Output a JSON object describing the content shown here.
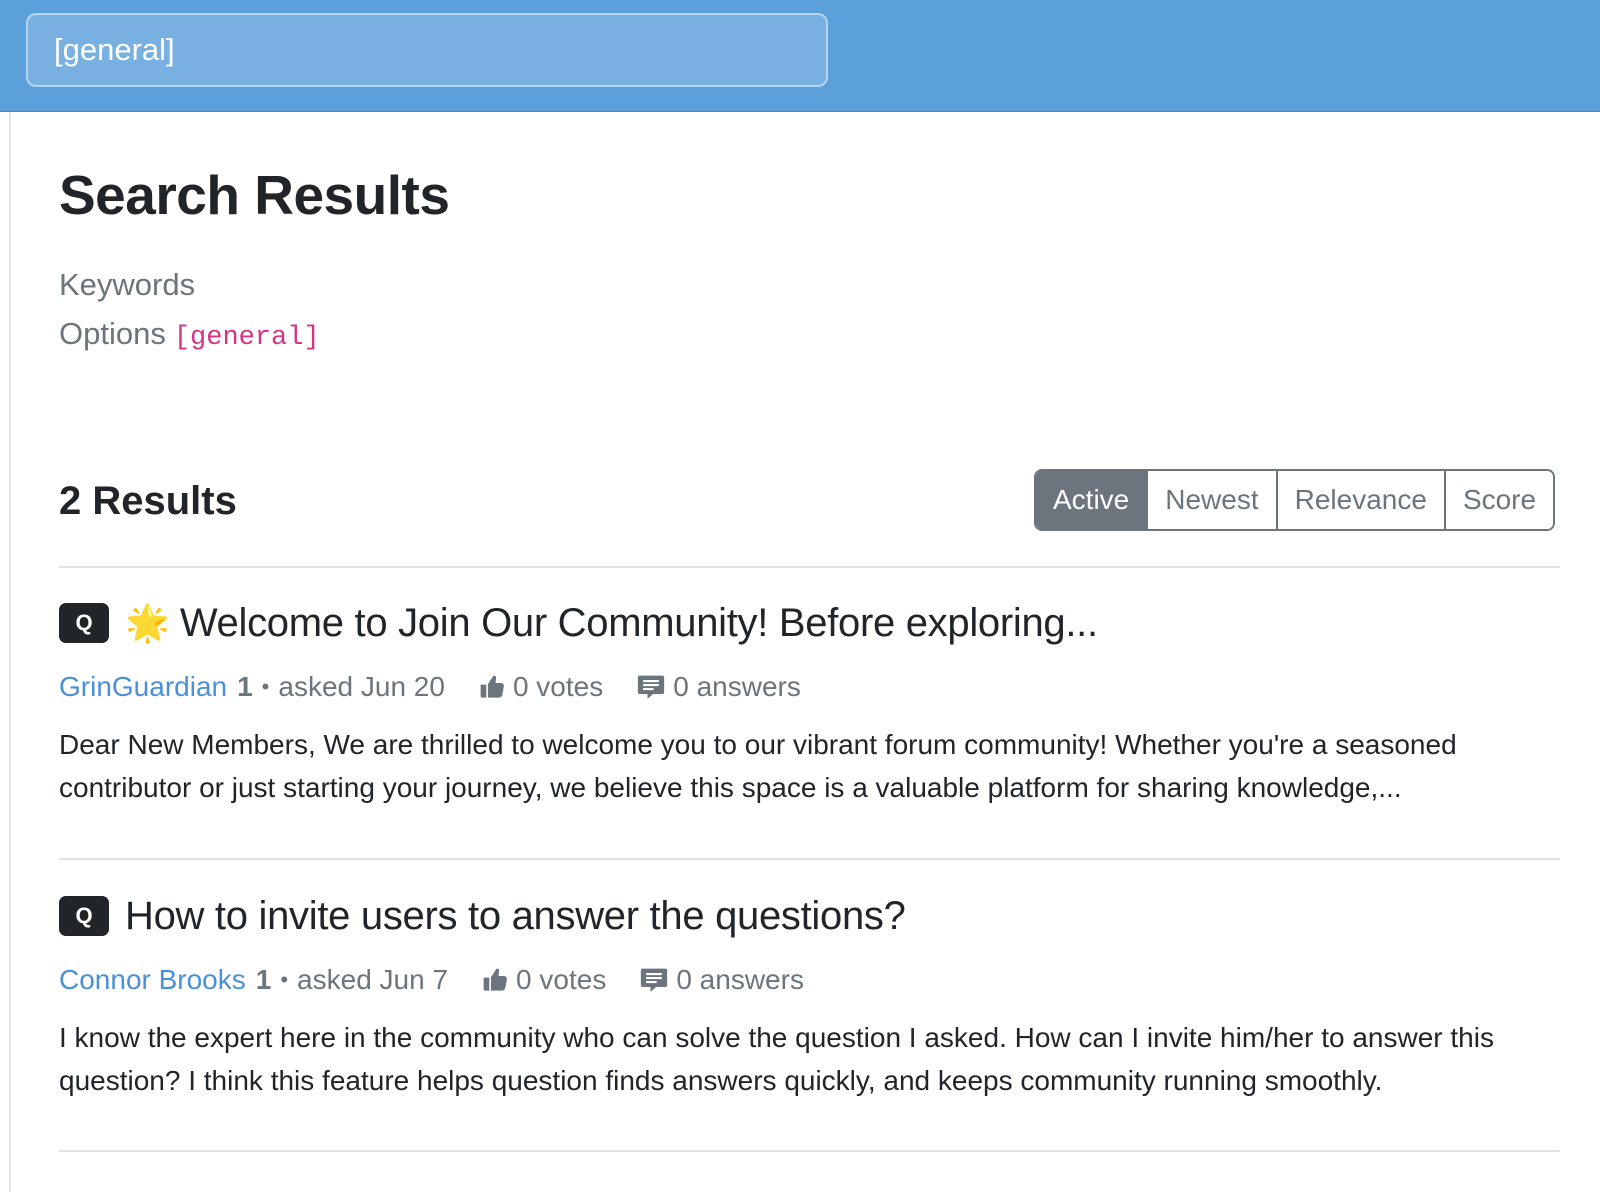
{
  "header": {
    "search_value": "[general]"
  },
  "page": {
    "title": "Search Results",
    "keywords_label": "Keywords",
    "options_label": "Options",
    "options_value": "[general]"
  },
  "results": {
    "count_label": "2 Results",
    "sort_options": [
      "Active",
      "Newest",
      "Relevance",
      "Score"
    ],
    "active_sort": "Active"
  },
  "questions": [
    {
      "badge": "Q",
      "star": "🌟",
      "title": "Welcome to Join Our Community! Before exploring...",
      "author": "GrinGuardian",
      "reputation": "1",
      "asked": "asked Jun 20",
      "votes": "0 votes",
      "answers": "0 answers",
      "excerpt": "Dear New Members, We are thrilled to welcome you to our vibrant forum community! Whether you're a seasoned contributor or just starting your journey, we believe this space is a valuable platform for sharing knowledge,..."
    },
    {
      "badge": "Q",
      "title": "How to invite users to answer the questions?",
      "author": "Connor Brooks",
      "reputation": "1",
      "asked": "asked Jun 7",
      "votes": "0 votes",
      "answers": "0 answers",
      "excerpt": "I know the expert here in the community who can solve the question I asked. How can I invite him/her to answer this question? I think this feature helps question finds answers quickly, and keeps community running smoothly."
    }
  ],
  "icons": {
    "votes": "thumbs-up-icon",
    "answers": "comment-icon"
  },
  "colors": {
    "header_bg": "#5b9fdb",
    "link": "#4a90d9",
    "code": "#d63384",
    "active_sort_bg": "#6c757d"
  }
}
